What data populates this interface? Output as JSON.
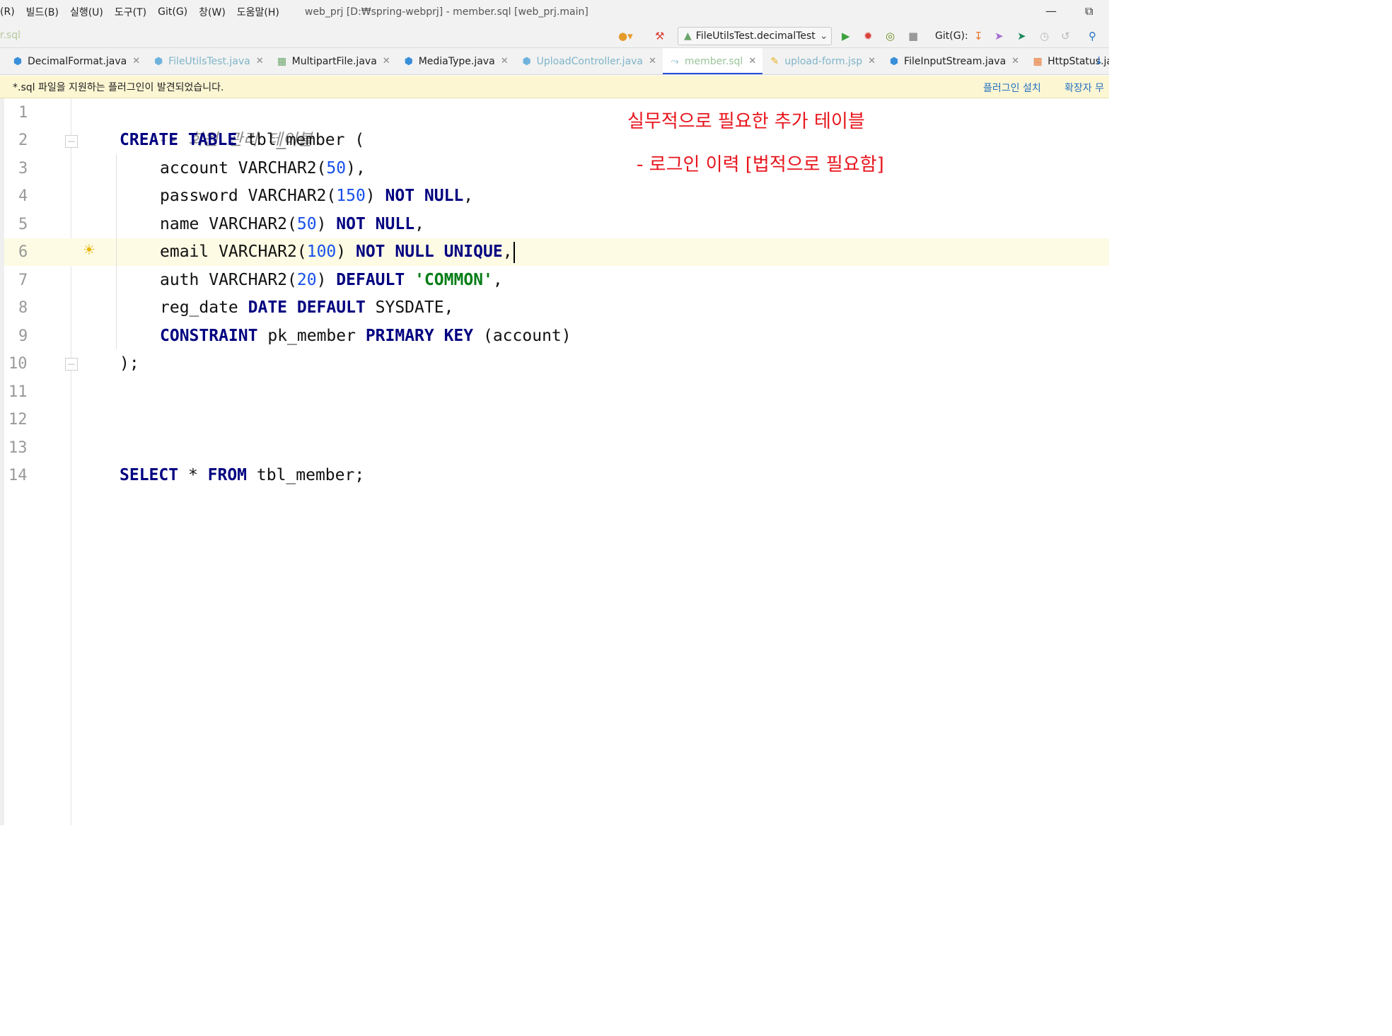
{
  "menu": {
    "items": [
      "(R)",
      "빌드(B)",
      "실행(U)",
      "도구(T)",
      "Git(G)",
      "창(W)",
      "도움말(H)"
    ],
    "window_title": "web_prj [D:₩spring-webprj] - member.sql [web_prj.main]"
  },
  "toolbar": {
    "breadcrumb": "r.sql",
    "run_config": "FileUtilsTest.decimalTest",
    "git_label": "Git(G):"
  },
  "tabs": [
    {
      "label": "DecimalFormat.java",
      "icon": "java-class-icon"
    },
    {
      "label": "FileUtilsTest.java",
      "icon": "java-test-icon"
    },
    {
      "label": "MultipartFile.java",
      "icon": "interface-icon"
    },
    {
      "label": "MediaType.java",
      "icon": "java-class-icon"
    },
    {
      "label": "UploadController.java",
      "icon": "java-class-icon"
    },
    {
      "label": "member.sql",
      "icon": "sql-file-icon"
    },
    {
      "label": "upload-form.jsp",
      "icon": "jsp-file-icon"
    },
    {
      "label": "FileInputStream.java",
      "icon": "java-class-icon"
    },
    {
      "label": "HttpStatus.java",
      "icon": "enum-icon"
    }
  ],
  "notification": {
    "message": "*.sql 파일을 지원하는 플러그인이 발견되었습니다.",
    "install_link": "플러그인 설치",
    "ignore_link": "확장자 무"
  },
  "editor": {
    "line_numbers": [
      "1",
      "2",
      "3",
      "4",
      "5",
      "6",
      "7",
      "8",
      "9",
      "10",
      "11",
      "12",
      "13",
      "14"
    ],
    "code": {
      "l1_comment": "-- 회원 관리 테이블",
      "l2_kw": "CREATE TABLE",
      "l2_rest": " tbl_member (",
      "l3_a": "account VARCHAR2(",
      "l3_n": "50",
      "l3_b": "),",
      "l4_a": "password VARCHAR2(",
      "l4_n": "150",
      "l4_b": ") ",
      "l4_kw": "NOT NULL",
      "l4_c": ",",
      "l5_a": "name VARCHAR2(",
      "l5_n": "50",
      "l5_b": ") ",
      "l5_kw": "NOT NULL",
      "l5_c": ",",
      "l6_a": "email VARCHAR2(",
      "l6_n": "100",
      "l6_b": ") ",
      "l6_kw": "NOT NULL UNIQUE",
      "l6_c": ",",
      "l7_a": "auth VARCHAR2(",
      "l7_n": "20",
      "l7_b": ") ",
      "l7_kw": "DEFAULT",
      "l7_sp": " ",
      "l7_s": "'COMMON'",
      "l7_c": ",",
      "l8_a": "reg_date ",
      "l8_kw": "DATE DEFAULT",
      "l8_b": " SYSDATE,",
      "l9_kw1": "CONSTRAINT",
      "l9_a": " pk_member ",
      "l9_kw2": "PRIMARY KEY",
      "l9_b": " (account)",
      "l10": ");",
      "l14_kw1": "SELECT",
      "l14_a": " * ",
      "l14_kw2": "FROM",
      "l14_b": " tbl_member;"
    }
  },
  "annotations": {
    "title": "실무적으로 필요한 추가 테이블",
    "item": "- 로그인 이력 [법적으로 필요함]"
  },
  "colors": {
    "annotation": "#e8141c",
    "keyword": "#000080",
    "number": "#1750eb",
    "string": "#067d17",
    "active_tab_underline": "#2a4fd7"
  }
}
